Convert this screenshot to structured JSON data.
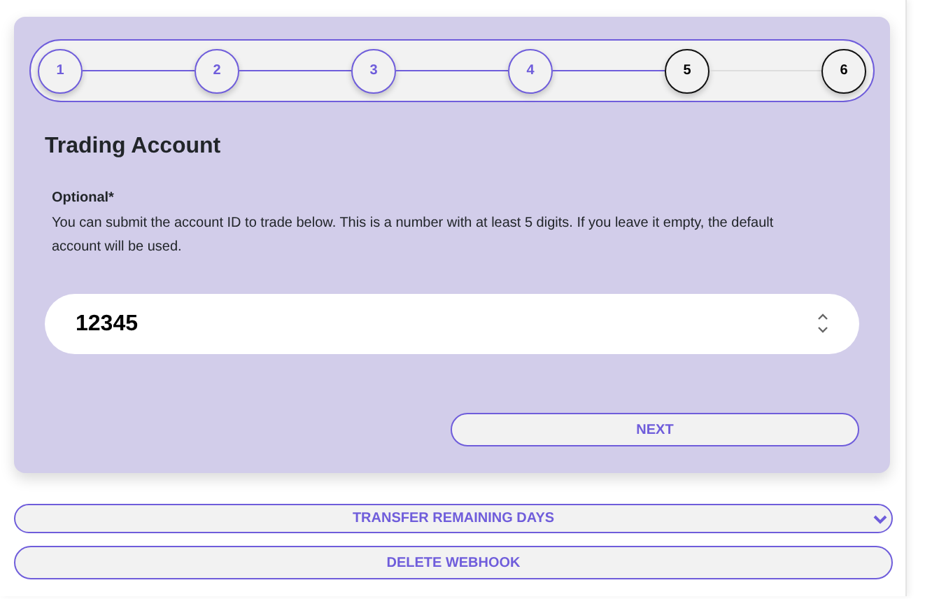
{
  "stepper": {
    "steps": [
      {
        "label": "1",
        "completed": true
      },
      {
        "label": "2",
        "completed": true
      },
      {
        "label": "3",
        "completed": true
      },
      {
        "label": "4",
        "completed": true
      },
      {
        "label": "5",
        "completed": false
      },
      {
        "label": "6",
        "completed": false
      }
    ]
  },
  "heading": "Trading Account",
  "field": {
    "label": "Optional*",
    "help": "You can submit the account ID to trade below. This is a number with at least 5 digits. If you leave it empty, the default account will be used.",
    "value": "12345"
  },
  "next_button": "NEXT",
  "transfer_button": "TRANSFER REMAINING DAYS",
  "delete_button": "DELETE WEBHOOK"
}
